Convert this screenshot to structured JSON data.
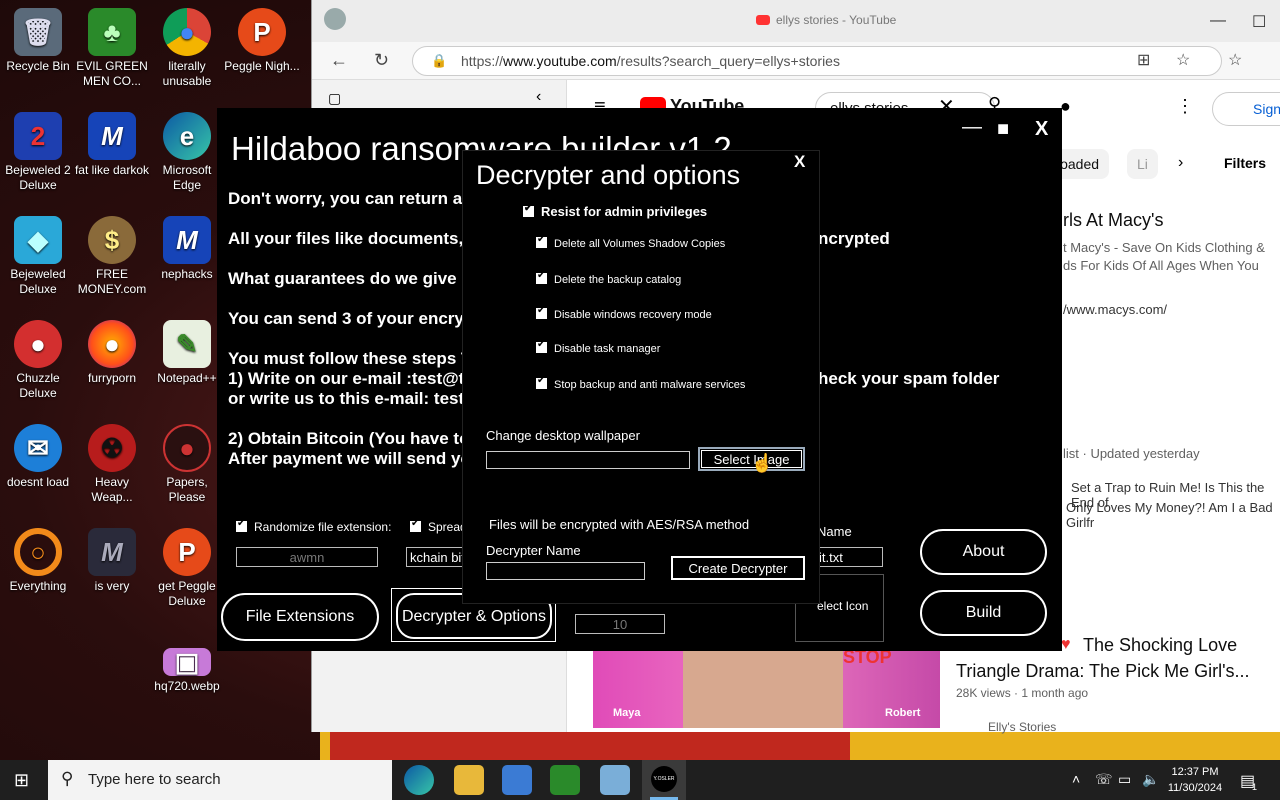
{
  "desktop": {
    "icons": [
      {
        "label": "Recycle Bin",
        "glyph": "🗑"
      },
      {
        "label": "EVIL GREEN MEN CO...",
        "glyph": "♣"
      },
      {
        "label": "literally unusable",
        "glyph": "●"
      },
      {
        "label": "Peggle Nigh...",
        "glyph": "P"
      },
      {
        "label": "Bejeweled 2 Deluxe",
        "glyph": "2"
      },
      {
        "label": "fat like darkok",
        "glyph": "M"
      },
      {
        "label": "Microsoft Edge",
        "glyph": "e"
      },
      {
        "label": "Bejeweled Deluxe",
        "glyph": "◆"
      },
      {
        "label": "FREE MONEY.com",
        "glyph": "$"
      },
      {
        "label": "nephacks",
        "glyph": "M"
      },
      {
        "label": "Chuzzle Deluxe",
        "glyph": "●"
      },
      {
        "label": "furryporn",
        "glyph": "●"
      },
      {
        "label": "Notepad++",
        "glyph": "✎"
      },
      {
        "label": "doesnt load",
        "glyph": "✉"
      },
      {
        "label": "Heavy Weap...",
        "glyph": "☢"
      },
      {
        "label": "Papers, Please",
        "glyph": "●"
      },
      {
        "label": "Everything",
        "glyph": "○"
      },
      {
        "label": "is very",
        "glyph": "M"
      },
      {
        "label": "get Peggle Deluxe",
        "glyph": "P"
      },
      {
        "label": "hq720.webp",
        "glyph": "▣"
      }
    ]
  },
  "browser": {
    "tab_title": "ellys stories - YouTube",
    "url_prefix": "https://",
    "url_domain": "www.youtube.com",
    "url_path": "/results?search_query=ellys+stories",
    "yt_logo": "YouTube",
    "yt_search_value": "ellys stories",
    "sign_in": "Sign",
    "chips": [
      "loaded",
      "Li"
    ],
    "filters": "Filters",
    "ad_title": "irls At Macy's",
    "ad_desc1": "t Macy's - Save On Kids Clothing &",
    "ad_desc2": "ds For Kids Of All Ages When You",
    "ad_url": "/www.macys.com/",
    "playlist_meta": "list · Updated yesterday",
    "playlist_item1": "Set a Trap to Ruin Me! Is This the End of",
    "playlist_item2": "Only Loves My Money?! Am I a Bad Girlfr",
    "video_title1": "The Shocking Love",
    "video_title2": "Triangle Drama: The Pick Me Girl's...",
    "video_meta": "28K views · 1 month ago",
    "channel": "Elly's Stories",
    "thumb_label_left": "Maya",
    "thumb_label_right": "Robert",
    "thumb_stop": "STOP"
  },
  "builder": {
    "title": "Hildaboo ransomware builder v1.2",
    "lines": [
      "Don't worry, you can return al",
      "All your files like documents, ",
      "What guarantees do we give ",
      "You can send 3 of your encry",
      "You must follow these steps T",
      "1) Write on our e-mail :test@t",
      "or write us to this e-mail: test",
      "2) Obtain Bitcoin (You have to",
      "After payment we will send yo"
    ],
    "line_encrypted": "ncrypted",
    "line_spam": "heck your spam folder",
    "randomize_label": "Randomize file extension:",
    "spread_label": "Spread",
    "ext_value": "awmn",
    "blockchain_value": "kchain bit",
    "name_label": "Name",
    "note_value": "it.txt",
    "select_icon": "elect Icon",
    "count_value": "10",
    "file_extensions_btn": "File Extensions",
    "decrypter_options_btn": "Decrypter & Options",
    "about_btn": "About",
    "build_btn": "Build"
  },
  "dialog": {
    "title": "Decrypter and options",
    "close": "X",
    "resist_admin": "Resist for admin privileges",
    "options": [
      "Delete all Volumes Shadow Copies",
      "Delete the backup catalog",
      "Disable windows recovery mode",
      "Disable task manager",
      "Stop backup and anti malware services"
    ],
    "wallpaper_label": "Change desktop wallpaper",
    "select_image_btn": "Select Image",
    "encryption_note": "Files will be encrypted with AES/RSA method",
    "decrypter_name_label": "Decrypter Name",
    "create_decrypter_btn": "Create Decrypter"
  },
  "taskbar": {
    "search_placeholder": "Type here to search",
    "time": "12:37 PM",
    "date": "11/30/2024",
    "notification_count": "1",
    "app_label": "Y.OSLER"
  }
}
